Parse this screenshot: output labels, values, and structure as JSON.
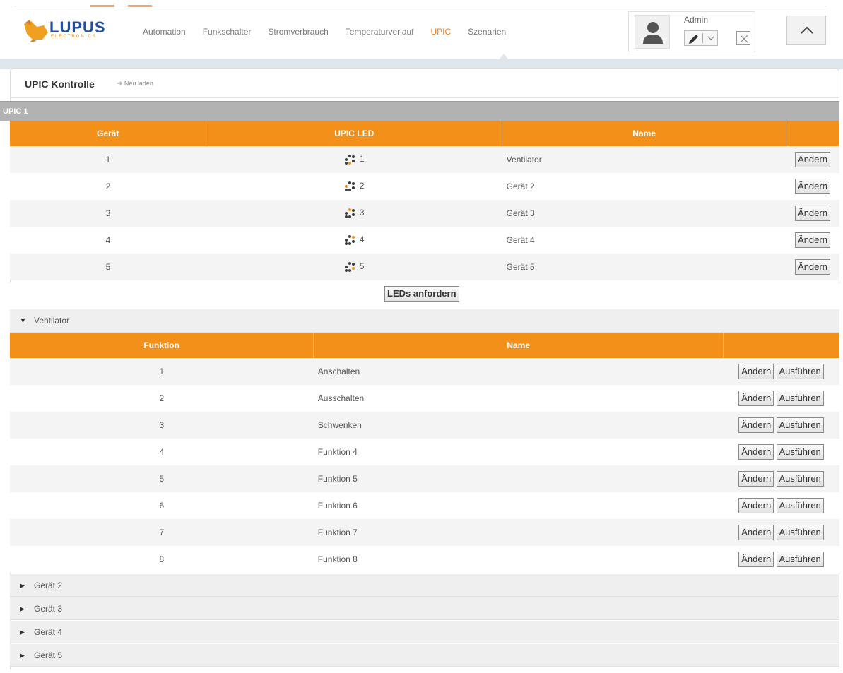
{
  "header": {
    "logo": {
      "text": "LUPUS",
      "sub": "ELECTRONICS"
    },
    "nav": [
      {
        "label": "Automation",
        "active": false
      },
      {
        "label": "Funkschalter",
        "active": false
      },
      {
        "label": "Stromverbrauch",
        "active": false
      },
      {
        "label": "Temperaturverlauf",
        "active": false
      },
      {
        "label": "UPIC",
        "active": true
      },
      {
        "label": "Szenarien",
        "active": false
      }
    ],
    "user": {
      "name": "Admin",
      "avatar_icon": "user-avatar-icon"
    },
    "colors": {
      "accent": "#f39019",
      "nav_active": "#ea7b1c",
      "brand": "#1f4f9e"
    }
  },
  "page": {
    "title": "UPIC Kontrolle",
    "reload_label": "Neu laden",
    "section_label": "UPIC 1"
  },
  "devices": {
    "columns": [
      "Gerät",
      "UPIC LED",
      "Name",
      ""
    ],
    "change_label": "Ändern",
    "rows": [
      {
        "id": "1",
        "led": "1",
        "name": "Ventilator"
      },
      {
        "id": "2",
        "led": "2",
        "name": "Gerät 2"
      },
      {
        "id": "3",
        "led": "3",
        "name": "Gerät 3"
      },
      {
        "id": "4",
        "led": "4",
        "name": "Gerät 4"
      },
      {
        "id": "5",
        "led": "5",
        "name": "Gerät 5"
      }
    ],
    "request_leds_label": "LEDs anfordern"
  },
  "ventilator": {
    "label": "Ventilator",
    "expanded": true,
    "columns": [
      "Funktion",
      "Name",
      ""
    ],
    "change_label": "Ändern",
    "execute_label": "Ausführen",
    "rows": [
      {
        "id": "1",
        "name": "Anschalten"
      },
      {
        "id": "2",
        "name": "Ausschalten"
      },
      {
        "id": "3",
        "name": "Schwenken"
      },
      {
        "id": "4",
        "name": "Funktion 4"
      },
      {
        "id": "5",
        "name": "Funktion 5"
      },
      {
        "id": "6",
        "name": "Funktion 6"
      },
      {
        "id": "7",
        "name": "Funktion 7"
      },
      {
        "id": "8",
        "name": "Funktion 8"
      }
    ]
  },
  "collapsed_devices": [
    {
      "label": "Gerät 2"
    },
    {
      "label": "Gerät 3"
    },
    {
      "label": "Gerät 4"
    },
    {
      "label": "Gerät 5"
    }
  ]
}
